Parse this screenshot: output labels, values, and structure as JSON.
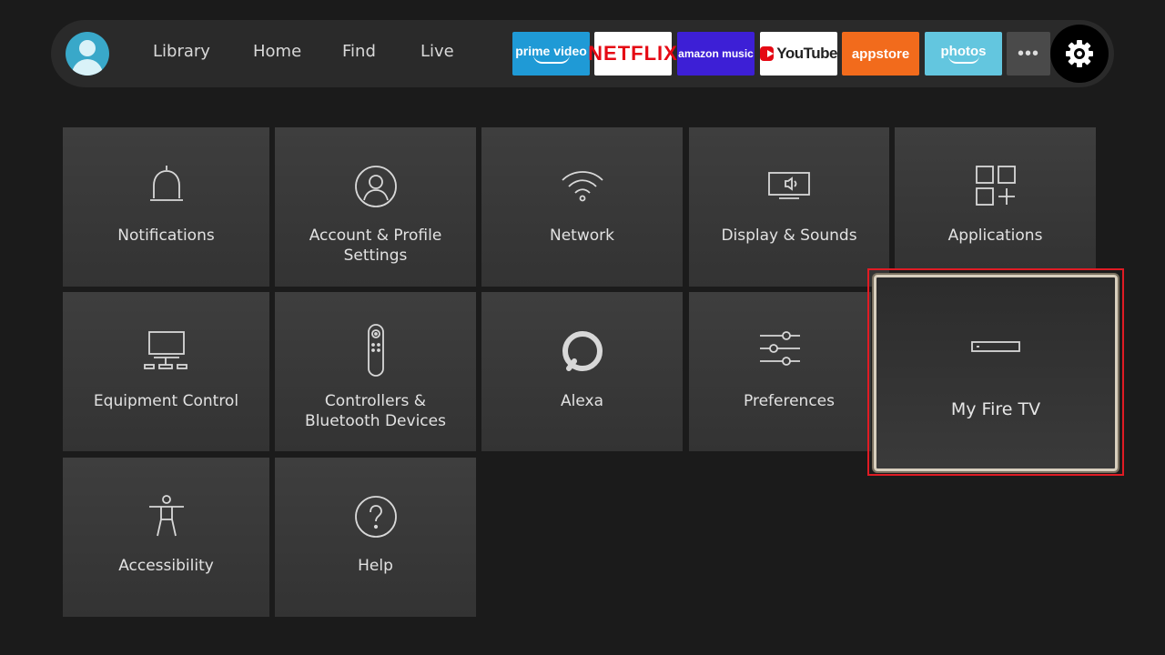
{
  "nav": {
    "links": [
      "Library",
      "Home",
      "Find",
      "Live"
    ],
    "apps": {
      "prime": "prime video",
      "netflix": "NETFLIX",
      "music": "amazon music",
      "youtube": "YouTube",
      "appstore": "appstore",
      "photos": "photos",
      "more": "•••"
    }
  },
  "settings": {
    "tiles": [
      "Notifications",
      "Account & Profile Settings",
      "Network",
      "Display & Sounds",
      "Applications",
      "Equipment Control",
      "Controllers & Bluetooth Devices",
      "Alexa",
      "Preferences",
      "Accessibility",
      "Help"
    ],
    "focused_tile": "My Fire TV"
  },
  "colors": {
    "background": "#1b1b1b",
    "tile": "#3a3a3a",
    "focus_border": "#d8cfbe",
    "highlight": "#e01b24"
  }
}
